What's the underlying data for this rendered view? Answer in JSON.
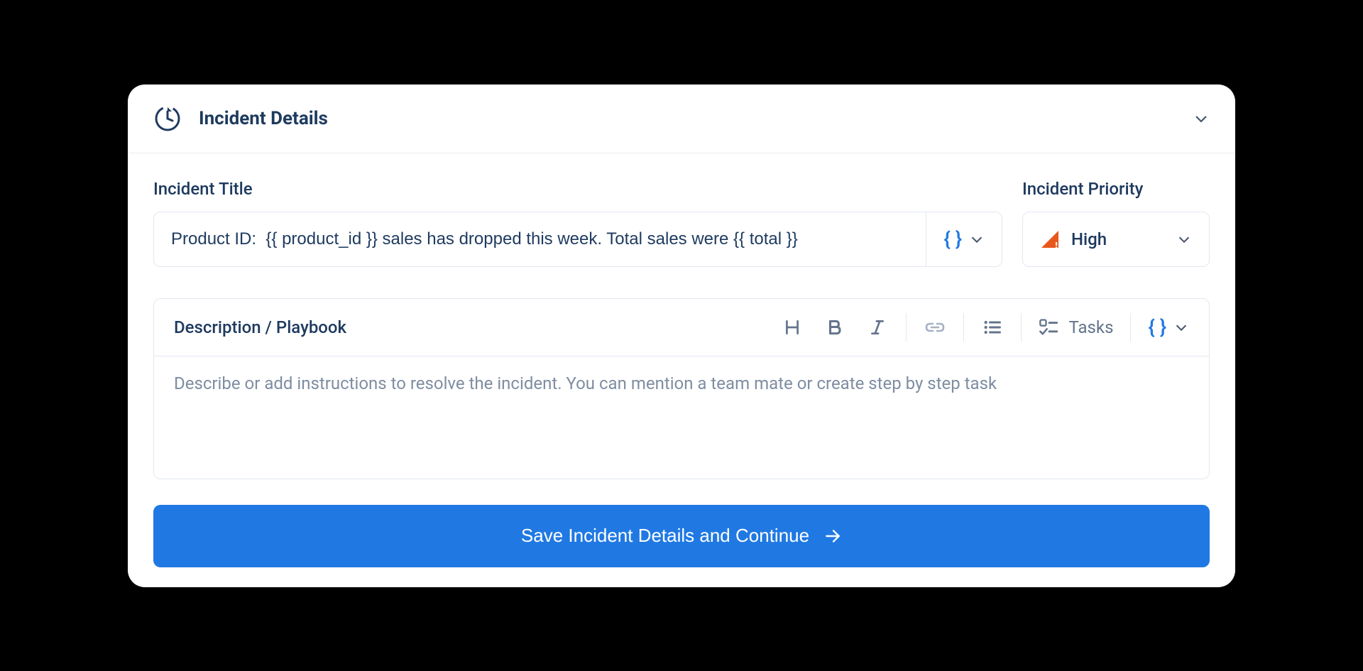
{
  "header": {
    "title": "Incident Details"
  },
  "form": {
    "title_label": "Incident Title",
    "title_value": "Product ID:  {{ product_id }} sales has dropped this week. Total sales were {{ total }}",
    "priority_label": "Incident Priority",
    "priority_value": "High"
  },
  "editor": {
    "label": "Description / Playbook",
    "placeholder": "Describe or add instructions to resolve the incident. You can mention a team mate or create step by step task",
    "tasks_label": "Tasks"
  },
  "actions": {
    "save_label": "Save Incident Details and Continue"
  }
}
